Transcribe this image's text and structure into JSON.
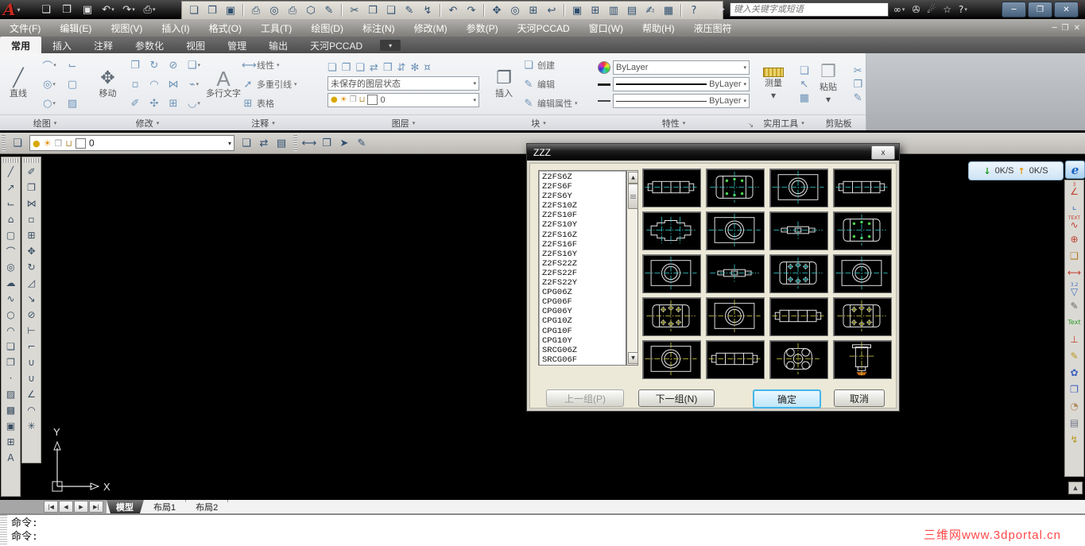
{
  "app": {
    "search_placeholder": "键入关键字或短语",
    "speed_down_icon": "↓",
    "speed_down": "0K/S",
    "speed_up_icon": "↑",
    "speed_up": "0K/S",
    "watermark": "三维网www.3dportal.cn"
  },
  "titlebar": {
    "logo_letter": "A",
    "qat": [
      {
        "n": "new-file-icon",
        "g": "❏"
      },
      {
        "n": "open-file-icon",
        "g": "❐"
      },
      {
        "n": "save-icon",
        "g": "▣"
      },
      {
        "n": "undo-icon",
        "g": "↶",
        "caret": true
      },
      {
        "n": "redo-icon",
        "g": "↷",
        "caret": true
      },
      {
        "n": "plot-icon",
        "g": "⎙",
        "caret": true
      }
    ],
    "classic": [
      [
        {
          "n": "new-icon",
          "g": "❏"
        },
        {
          "n": "open-icon",
          "g": "❐"
        },
        {
          "n": "save-icon",
          "g": "▣"
        }
      ],
      [
        {
          "n": "plot-icon",
          "g": "⎙"
        },
        {
          "n": "preview-icon",
          "g": "◎"
        },
        {
          "n": "publish-icon",
          "g": "⎙"
        },
        {
          "n": "palette-icon",
          "g": "⬡"
        },
        {
          "n": "markup-icon",
          "g": "✎"
        }
      ],
      [
        {
          "n": "cut-icon",
          "g": "✂"
        },
        {
          "n": "copy-icon",
          "g": "❐"
        },
        {
          "n": "paste-icon",
          "g": "❑"
        },
        {
          "n": "matchprop-icon",
          "g": "✎"
        },
        {
          "n": "block-editor-icon",
          "g": "↯"
        }
      ],
      [
        {
          "n": "undo-icon",
          "g": "↶"
        },
        {
          "n": "redo-icon",
          "g": "↷"
        }
      ],
      [
        {
          "n": "pan-icon",
          "g": "✥"
        },
        {
          "n": "zoom-realtime-icon",
          "g": "◎"
        },
        {
          "n": "zoom-window-icon",
          "g": "⊞"
        },
        {
          "n": "zoom-previous-icon",
          "g": "↩"
        }
      ],
      [
        {
          "n": "properties-icon",
          "g": "▣"
        },
        {
          "n": "designcenter-icon",
          "g": "⊞"
        },
        {
          "n": "tool-palettes-icon",
          "g": "▥"
        },
        {
          "n": "sheetset-icon",
          "g": "▤"
        },
        {
          "n": "markup-set-icon",
          "g": "✍"
        },
        {
          "n": "quickcalc-icon",
          "g": "▦"
        }
      ],
      [
        {
          "n": "help-icon",
          "g": "?"
        }
      ]
    ],
    "toolbar_close": "✕",
    "search_toggle": "▶",
    "search_icons": [
      {
        "n": "search-binoculars-icon",
        "g": "∞",
        "caret": true
      },
      {
        "n": "communication-key-icon",
        "g": "✇"
      },
      {
        "n": "subscription-satellite-icon",
        "g": "☄"
      },
      {
        "n": "favorites-star-icon",
        "g": "☆"
      },
      {
        "n": "help-circle-icon",
        "g": "?",
        "caret": true
      }
    ],
    "window_controls": [
      {
        "n": "minimize-button",
        "g": "─"
      },
      {
        "n": "restore-button",
        "g": "❐"
      },
      {
        "n": "close-button",
        "g": "✕"
      }
    ]
  },
  "menubar": {
    "items": [
      "文件(F)",
      "编辑(E)",
      "视图(V)",
      "插入(I)",
      "格式(O)",
      "工具(T)",
      "绘图(D)",
      "标注(N)",
      "修改(M)",
      "参数(P)",
      "天河PCCAD",
      "窗口(W)",
      "帮助(H)",
      "液压图符"
    ],
    "window_controls": [
      {
        "n": "doc-minimize-button",
        "g": "─"
      },
      {
        "n": "doc-restore-button",
        "g": "❐"
      },
      {
        "n": "doc-close-button",
        "g": "✕"
      }
    ]
  },
  "ribbon": {
    "tabs": [
      {
        "label": "常用",
        "active": true
      },
      {
        "label": "插入",
        "active": false
      },
      {
        "label": "注释",
        "active": false
      },
      {
        "label": "参数化",
        "active": false
      },
      {
        "label": "视图",
        "active": false
      },
      {
        "label": "管理",
        "active": false
      },
      {
        "label": "输出",
        "active": false
      },
      {
        "label": "天河PCCAD",
        "active": false
      }
    ],
    "overflow_icon": "▾",
    "panels": {
      "draw": {
        "big_label": "直线",
        "big_icon": "╱",
        "grid": [
          {
            "n": "arc-icon",
            "g": "⌒",
            "caret": true
          },
          {
            "n": "polyline-icon",
            "g": "⌙"
          },
          {
            "n": "circle-icon",
            "g": "◎",
            "caret": true
          },
          {
            "n": "rectangle-icon",
            "g": "▢"
          },
          {
            "n": "ellipse-icon",
            "g": "○",
            "caret": true
          },
          {
            "n": "hatch-icon",
            "g": "▨"
          }
        ],
        "footer": "绘图"
      },
      "modify": {
        "big_label": "移动",
        "big_icon": "✥",
        "grid": [
          {
            "n": "copy-icon",
            "g": "❐"
          },
          {
            "n": "rotate-icon",
            "g": "↻"
          },
          {
            "n": "trim-icon",
            "g": "⊘"
          },
          {
            "n": "array-icon",
            "g": "❑",
            "caret": true
          },
          {
            "n": "offset-icon",
            "g": "▫"
          },
          {
            "n": "fillet-icon",
            "g": "◠"
          },
          {
            "n": "mirror-icon",
            "g": "⋈"
          },
          {
            "n": "break-icon",
            "g": "⌁",
            "caret": true
          },
          {
            "n": "erase-icon",
            "g": "✐"
          },
          {
            "n": "3d-rotate-icon",
            "g": "✣"
          },
          {
            "n": "explode-icon",
            "g": "⊞"
          },
          {
            "n": "chamfer-icon",
            "g": "◡",
            "caret": true
          }
        ],
        "footer": "修改"
      },
      "annotate": {
        "big_label": "多行文字",
        "big_icon": "A",
        "big_caret": true,
        "items": [
          {
            "n": "linear-dim-icon",
            "g": "⟷",
            "label": "线性",
            "caret": true
          },
          {
            "n": "multileader-icon",
            "g": "➚",
            "label": "多重引线",
            "caret": true
          },
          {
            "n": "table-icon",
            "g": "⊞",
            "label": "表格",
            "caret": false
          }
        ],
        "footer": "注释"
      },
      "layers": {
        "icon_row": [
          {
            "n": "layer-properties-icon",
            "g": "❏"
          },
          {
            "n": "layer-match-icon",
            "g": "❐"
          },
          {
            "n": "layer-prev-icon",
            "g": "❑"
          },
          {
            "n": "layer-change-icon",
            "g": "⇄"
          },
          {
            "n": "layer-isolate-icon",
            "g": "❒"
          },
          {
            "n": "layer-unisolate-icon",
            "g": "⇵"
          },
          {
            "n": "layer-freeze-icon",
            "g": "✻"
          },
          {
            "n": "layer-off-icon",
            "g": "¤"
          }
        ],
        "state_value": "未保存的图层状态",
        "layer_icons": [
          {
            "n": "bulb-icon",
            "g": "●",
            "c": "#d8a800"
          },
          {
            "n": "sun-icon",
            "g": "☀",
            "c": "#e08a00"
          },
          {
            "n": "freeze-icon",
            "g": "❐",
            "c": "#9a9a9a"
          },
          {
            "n": "unlock-icon",
            "g": "⊔",
            "c": "#b08a30"
          }
        ],
        "layer_value": "0",
        "footer": "图层"
      },
      "block": {
        "big_label": "插入",
        "big_icon": "❐",
        "items": [
          {
            "n": "block-create-icon",
            "g": "❏",
            "label": "创建",
            "caret": false
          },
          {
            "n": "block-edit-icon",
            "g": "✎",
            "label": "编辑",
            "caret": false
          },
          {
            "n": "attribute-edit-icon",
            "g": "✎",
            "label": "编辑属性",
            "caret": true
          }
        ],
        "footer": "块"
      },
      "properties": {
        "rows": [
          {
            "lead": "swatch",
            "value": "ByLayer"
          },
          {
            "lead": "thick",
            "value": "ByLayer"
          },
          {
            "lead": "thin",
            "value": "ByLayer"
          }
        ],
        "footer": "特性",
        "launcher": "↘"
      },
      "utilities": {
        "big_label": "测量",
        "big_caret": true,
        "side": [
          {
            "n": "quick-select-icon",
            "g": "❏"
          },
          {
            "n": "point-id-icon",
            "g": "↖"
          },
          {
            "n": "quick-calc-icon",
            "g": "▦"
          }
        ],
        "footer": "实用工具"
      },
      "clipboard": {
        "big_label": "粘贴",
        "big_icon": "❒",
        "big_caret": true,
        "side": [
          {
            "n": "cut-icon",
            "g": "✂"
          },
          {
            "n": "copy-clip-icon",
            "g": "❐"
          },
          {
            "n": "paste-special-icon",
            "g": "✎"
          }
        ],
        "footer": "剪贴板"
      }
    }
  },
  "toolrow": {
    "g1": [
      {
        "n": "layer-properties-icon",
        "g": "❏"
      }
    ],
    "combo_icons": [
      {
        "n": "bulb-icon",
        "g": "●",
        "c": "#d8a800"
      },
      {
        "n": "sun-icon",
        "g": "☀",
        "c": "#e08a00"
      },
      {
        "n": "freeze-icon",
        "g": "❐",
        "c": "#9a9a9a"
      },
      {
        "n": "unlock-icon",
        "g": "⊔",
        "c": "#b08a30"
      }
    ],
    "layer_value": "0",
    "combo_caret": "▾",
    "g2": [
      {
        "n": "layer-states-icon",
        "g": "❏"
      },
      {
        "n": "layer-prev-icon",
        "g": "⇄"
      },
      {
        "n": "layer-translate-icon",
        "g": "▤"
      }
    ],
    "g3": [
      {
        "n": "distance-icon",
        "g": "⟷"
      },
      {
        "n": "block-icon",
        "g": "❐"
      },
      {
        "n": "script-icon",
        "g": "➤"
      },
      {
        "n": "sketch-icon",
        "g": "✎"
      }
    ]
  },
  "side_toolbars": {
    "draw": [
      {
        "n": "line-icon",
        "g": "╱"
      },
      {
        "n": "ray-icon",
        "g": "↗"
      },
      {
        "n": "polyline-icon",
        "g": "⌙"
      },
      {
        "n": "polygon-icon",
        "g": "⌂"
      },
      {
        "n": "rectangle-icon",
        "g": "▢"
      },
      {
        "n": "arc-icon",
        "g": "⌒"
      },
      {
        "n": "circle-icon",
        "g": "◎"
      },
      {
        "n": "revcloud-icon",
        "g": "☁"
      },
      {
        "n": "spline-icon",
        "g": "∿"
      },
      {
        "n": "ellipse-icon",
        "g": "○"
      },
      {
        "n": "ellipse-arc-icon",
        "g": "◠"
      },
      {
        "n": "insert-block-icon",
        "g": "❏"
      },
      {
        "n": "make-block-icon",
        "g": "❐"
      },
      {
        "n": "point-icon",
        "g": "·"
      },
      {
        "n": "hatch-icon",
        "g": "▨"
      },
      {
        "n": "gradient-icon",
        "g": "▩"
      },
      {
        "n": "region-icon",
        "g": "▣"
      },
      {
        "n": "table-icon",
        "g": "⊞"
      },
      {
        "n": "mtext-icon",
        "g": "A"
      }
    ],
    "modify": [
      {
        "n": "erase-icon",
        "g": "✐"
      },
      {
        "n": "copy-icon",
        "g": "❐"
      },
      {
        "n": "mirror-icon",
        "g": "⋈"
      },
      {
        "n": "offset-icon",
        "g": "▫"
      },
      {
        "n": "array-icon",
        "g": "⊞"
      },
      {
        "n": "move-icon",
        "g": "✥"
      },
      {
        "n": "rotate-icon",
        "g": "↻"
      },
      {
        "n": "scale-icon",
        "g": "◿"
      },
      {
        "n": "stretch-icon",
        "g": "↘"
      },
      {
        "n": "trim-icon",
        "g": "⊘"
      },
      {
        "n": "extend-icon",
        "g": "⊢"
      },
      {
        "n": "break-point-icon",
        "g": "⌐"
      },
      {
        "n": "break-icon",
        "g": "∪"
      },
      {
        "n": "join-icon",
        "g": "∪"
      },
      {
        "n": "chamfer-icon",
        "g": "∠"
      },
      {
        "n": "fillet-icon",
        "g": "◠"
      },
      {
        "n": "explode-icon",
        "g": "✳"
      }
    ]
  },
  "right_toolbar": {
    "items": [
      {
        "n": "chamfer-dim-icon",
        "g": "∠",
        "c": "#c04030",
        "sub": "3"
      },
      {
        "n": "ordinate-dim-icon",
        "g": "⌞",
        "c": "#3a6fc0"
      },
      {
        "n": "text-leader-icon",
        "g": "∿",
        "c": "#c04030",
        "sub": "TEXT"
      },
      {
        "n": "diameter-dim-icon",
        "g": "⊕",
        "c": "#c04030"
      },
      {
        "n": "copy-object-icon",
        "g": "❑",
        "c": "#b07820"
      },
      {
        "n": "linear-dim-icon",
        "g": "⟷",
        "c": "#c04030"
      },
      {
        "n": "roughness-icon",
        "g": "▽",
        "c": "#3a6fc0",
        "sub": "3.2"
      },
      {
        "n": "sketch-icon",
        "g": "✎",
        "c": "#666666"
      },
      {
        "n": "text-style-icon",
        "g": "Text",
        "c": "#2a9a2a"
      },
      {
        "n": "datum-icon",
        "g": "⊥",
        "c": "#c04030"
      },
      {
        "n": "attribute-edit-icon",
        "g": "✎",
        "c": "#b89a20"
      },
      {
        "n": "symbol-library-icon",
        "g": "✿",
        "c": "#3a5fc0"
      },
      {
        "n": "view-frame-icon",
        "g": "❐",
        "c": "#3a5fc0"
      },
      {
        "n": "balloon-icon",
        "g": "◔",
        "c": "#b08a60"
      },
      {
        "n": "title-block-icon",
        "g": "▤",
        "c": "#707888"
      },
      {
        "n": "bolt-icon",
        "g": "↯",
        "c": "#b89a20"
      }
    ],
    "scroll_up": "▲"
  },
  "ucs": {
    "x_label": "X",
    "y_label": "Y"
  },
  "dialog": {
    "title": "ZZZ",
    "close_icon": "x",
    "items": [
      "Z2FS6Z",
      "Z2FS6F",
      "Z2FS6Y",
      "Z2FS10Z",
      "Z2FS10F",
      "Z2FS10Y",
      "Z2FS16Z",
      "Z2FS16F",
      "Z2FS16Y",
      "Z2FS22Z",
      "Z2FS22F",
      "Z2FS22Y",
      "CPG06Z",
      "CPG06F",
      "CPG06Y",
      "CPG10Z",
      "CPG10F",
      "CPG10Y",
      "SRCG06Z",
      "SRCG06F"
    ],
    "scrollbar": {
      "up": "▲",
      "down": "▼"
    },
    "thumbnails": [
      {
        "kind": "side",
        "accent": "cyan"
      },
      {
        "kind": "boltTop",
        "accent": "cyan",
        "dots": true
      },
      {
        "kind": "circleBlock",
        "accent": "cyan"
      },
      {
        "kind": "side",
        "accent": "cyan"
      },
      {
        "kind": "stepped",
        "accent": "cyan"
      },
      {
        "kind": "circleBlock",
        "accent": "cyan"
      },
      {
        "kind": "spindle",
        "accent": "cyan"
      },
      {
        "kind": "boltTop",
        "accent": "cyan",
        "dots": true
      },
      {
        "kind": "circleBlock",
        "accent": "cyan"
      },
      {
        "kind": "spindle",
        "accent": "cyan"
      },
      {
        "kind": "boltTop",
        "accent": "cyan"
      },
      {
        "kind": "circleBlock",
        "accent": "cyan"
      },
      {
        "kind": "boltTop",
        "accent": "yellow"
      },
      {
        "kind": "circleBlock",
        "accent": "yellow"
      },
      {
        "kind": "side",
        "accent": "yellow"
      },
      {
        "kind": "boltTop",
        "accent": "yellow"
      },
      {
        "kind": "circleBlock",
        "accent": "yellow"
      },
      {
        "kind": "side",
        "accent": "yellow"
      },
      {
        "kind": "clover",
        "accent": "yellow"
      },
      {
        "kind": "vert",
        "accent": "yellow"
      }
    ],
    "buttons": {
      "prev": "上一组(P)",
      "next": "下一组(N)",
      "ok": "确定",
      "cancel": "取消"
    }
  },
  "layout_tabs": {
    "nav": [
      {
        "n": "tab-first-icon",
        "g": "|◀"
      },
      {
        "n": "tab-prev-icon",
        "g": "◀"
      },
      {
        "n": "tab-next-icon",
        "g": "▶"
      },
      {
        "n": "tab-last-icon",
        "g": "▶|"
      }
    ],
    "tabs": [
      {
        "label": "模型",
        "active": true
      },
      {
        "label": "布局1",
        "active": false
      },
      {
        "label": "布局2",
        "active": false
      }
    ]
  },
  "command": {
    "lines": [
      "命令:",
      "命令:"
    ]
  }
}
